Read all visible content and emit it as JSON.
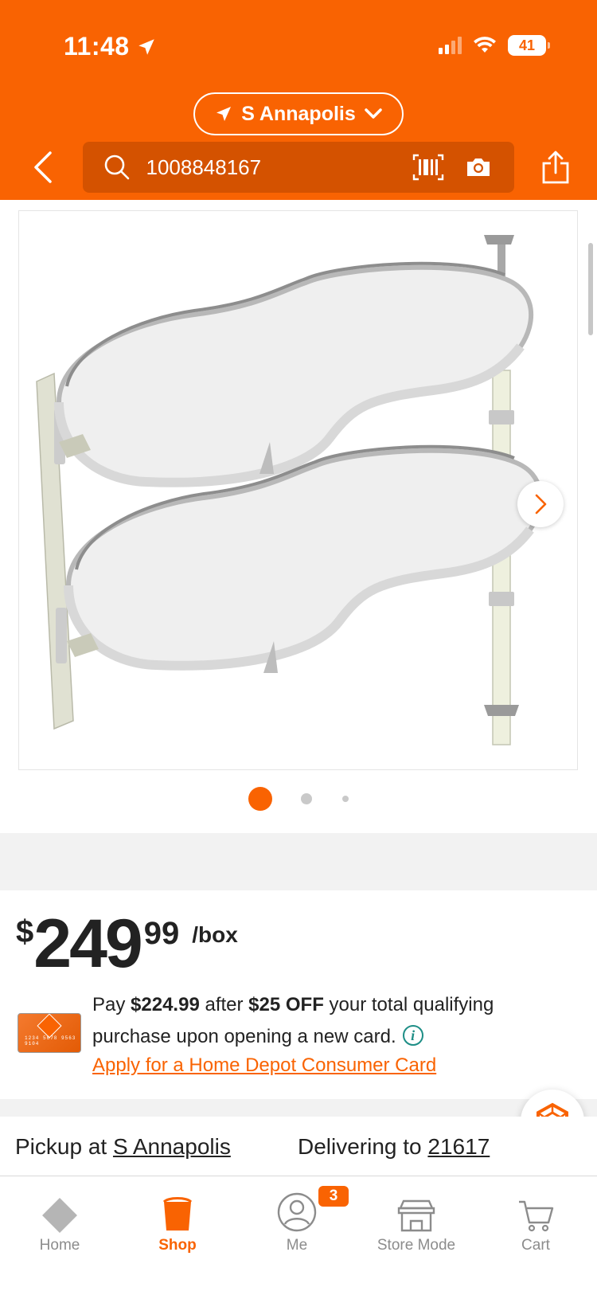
{
  "status_bar": {
    "time": "11:48",
    "battery": "41"
  },
  "header": {
    "store_name": "S Annapolis",
    "search": {
      "value": "1008848167",
      "placeholder": ""
    },
    "accent_color": "#f96302"
  },
  "gallery": {
    "image_count": 3,
    "active_index": 0
  },
  "price": {
    "dollar_sign": "$",
    "whole": "249",
    "cents": "99",
    "unit": "/box"
  },
  "card_offer": {
    "pay_prefix": "Pay ",
    "discounted_price": "$224.99",
    "after_text": " after ",
    "discount": "$25 OFF",
    "suffix": " your total qualifying purchase upon opening a new card.",
    "link_text": "Apply for a Home Depot Consumer Card",
    "card_number": "1234 5678 9563 9104"
  },
  "fulfillment": {
    "pickup_label": "Pickup at ",
    "pickup_store": "S Annapolis",
    "delivery_label": "Delivering to ",
    "delivery_zip": "21617"
  },
  "tabbar": {
    "tabs": [
      {
        "label": "Home",
        "icon": "home-depot-logo-icon"
      },
      {
        "label": "Shop",
        "icon": "bucket-icon"
      },
      {
        "label": "Me",
        "icon": "user-icon"
      },
      {
        "label": "Store Mode",
        "icon": "store-icon"
      },
      {
        "label": "Cart",
        "icon": "cart-icon"
      }
    ],
    "active": "Shop",
    "me_badge": "3"
  }
}
